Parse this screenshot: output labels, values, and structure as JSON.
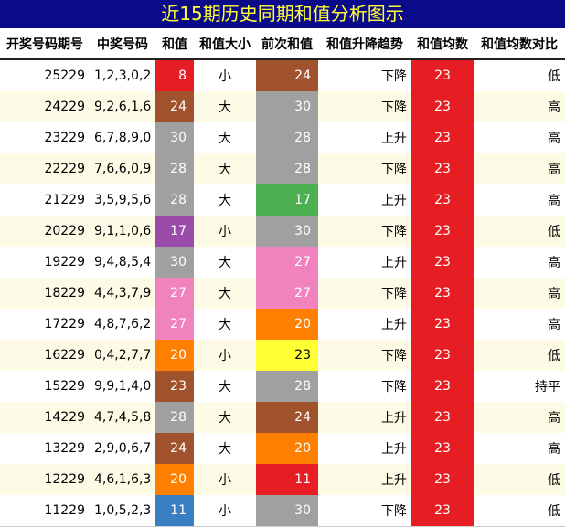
{
  "title": "近15期历史同期和值分析图示",
  "colors": {
    "title_bg": "#0b0b8a",
    "title_text": "#ffff33",
    "avg_bg": "#e61e24",
    "sum_palette": {
      "8": "#e61e24",
      "11": "#3a7fc1",
      "17": "#9b4ca8",
      "20": "#ff8000",
      "23": "#a0522d",
      "24": "#a0522d",
      "27": "#f082be",
      "28": "#a0a0a0",
      "30": "#a0a0a0"
    }
  },
  "headers": [
    "开奖号码期号",
    "中奖号码",
    "和值",
    "和值大小",
    "前次和值",
    "和值升降趋势",
    "和值均数",
    "和值均数对比"
  ],
  "rows": [
    {
      "period": "25229",
      "numbers": "1,2,3,0,2",
      "sum": "8",
      "size": "小",
      "prev": "24",
      "trend": "下降",
      "avg": "23",
      "compare": "低",
      "sum_color": "#e61e24",
      "prev_color": "#a0522d",
      "prev_text": "#ffffff"
    },
    {
      "period": "24229",
      "numbers": "9,2,6,1,6",
      "sum": "24",
      "size": "大",
      "prev": "30",
      "trend": "下降",
      "avg": "23",
      "compare": "高",
      "sum_color": "#a0522d",
      "prev_color": "#a0a0a0",
      "prev_text": "#ffffff"
    },
    {
      "period": "23229",
      "numbers": "6,7,8,9,0",
      "sum": "30",
      "size": "大",
      "prev": "28",
      "trend": "上升",
      "avg": "23",
      "compare": "高",
      "sum_color": "#a0a0a0",
      "prev_color": "#a0a0a0",
      "prev_text": "#ffffff"
    },
    {
      "period": "22229",
      "numbers": "7,6,6,0,9",
      "sum": "28",
      "size": "大",
      "prev": "28",
      "trend": "下降",
      "avg": "23",
      "compare": "高",
      "sum_color": "#a0a0a0",
      "prev_color": "#a0a0a0",
      "prev_text": "#ffffff"
    },
    {
      "period": "21229",
      "numbers": "3,5,9,5,6",
      "sum": "28",
      "size": "大",
      "prev": "17",
      "trend": "上升",
      "avg": "23",
      "compare": "高",
      "sum_color": "#a0a0a0",
      "prev_color": "#4caf50",
      "prev_text": "#ffffff"
    },
    {
      "period": "20229",
      "numbers": "9,1,1,0,6",
      "sum": "17",
      "size": "小",
      "prev": "30",
      "trend": "下降",
      "avg": "23",
      "compare": "低",
      "sum_color": "#9b4ca8",
      "prev_color": "#a0a0a0",
      "prev_text": "#ffffff"
    },
    {
      "period": "19229",
      "numbers": "9,4,8,5,4",
      "sum": "30",
      "size": "大",
      "prev": "27",
      "trend": "上升",
      "avg": "23",
      "compare": "高",
      "sum_color": "#a0a0a0",
      "prev_color": "#f082be",
      "prev_text": "#ffffff"
    },
    {
      "period": "18229",
      "numbers": "4,4,3,7,9",
      "sum": "27",
      "size": "大",
      "prev": "27",
      "trend": "下降",
      "avg": "23",
      "compare": "高",
      "sum_color": "#f082be",
      "prev_color": "#f082be",
      "prev_text": "#ffffff"
    },
    {
      "period": "17229",
      "numbers": "4,8,7,6,2",
      "sum": "27",
      "size": "大",
      "prev": "20",
      "trend": "上升",
      "avg": "23",
      "compare": "高",
      "sum_color": "#f082be",
      "prev_color": "#ff8000",
      "prev_text": "#ffffff"
    },
    {
      "period": "16229",
      "numbers": "0,4,2,7,7",
      "sum": "20",
      "size": "小",
      "prev": "23",
      "trend": "下降",
      "avg": "23",
      "compare": "低",
      "sum_color": "#ff8000",
      "prev_color": "#ffff33",
      "prev_text": "#000000"
    },
    {
      "period": "15229",
      "numbers": "9,9,1,4,0",
      "sum": "23",
      "size": "大",
      "prev": "28",
      "trend": "下降",
      "avg": "23",
      "compare": "持平",
      "sum_color": "#a0522d",
      "prev_color": "#a0a0a0",
      "prev_text": "#ffffff"
    },
    {
      "period": "14229",
      "numbers": "4,7,4,5,8",
      "sum": "28",
      "size": "大",
      "prev": "24",
      "trend": "上升",
      "avg": "23",
      "compare": "高",
      "sum_color": "#a0a0a0",
      "prev_color": "#a0522d",
      "prev_text": "#ffffff"
    },
    {
      "period": "13229",
      "numbers": "2,9,0,6,7",
      "sum": "24",
      "size": "大",
      "prev": "20",
      "trend": "上升",
      "avg": "23",
      "compare": "高",
      "sum_color": "#a0522d",
      "prev_color": "#ff8000",
      "prev_text": "#ffffff"
    },
    {
      "period": "12229",
      "numbers": "4,6,1,6,3",
      "sum": "20",
      "size": "小",
      "prev": "11",
      "trend": "上升",
      "avg": "23",
      "compare": "低",
      "sum_color": "#ff8000",
      "prev_color": "#e61e24",
      "prev_text": "#ffffff"
    },
    {
      "period": "11229",
      "numbers": "1,0,5,2,3",
      "sum": "11",
      "size": "小",
      "prev": "30",
      "trend": "下降",
      "avg": "23",
      "compare": "低",
      "sum_color": "#3a7fc1",
      "prev_color": "#a0a0a0",
      "prev_text": "#ffffff"
    }
  ]
}
